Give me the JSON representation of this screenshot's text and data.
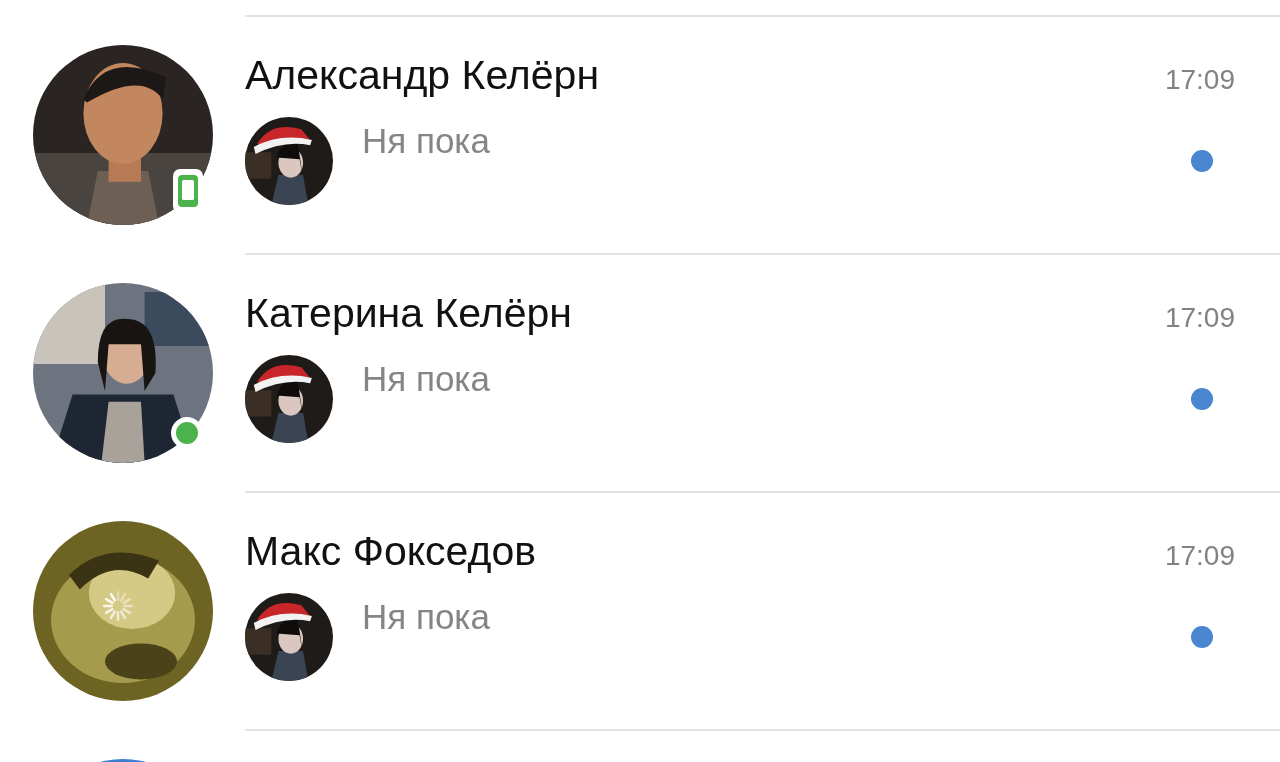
{
  "chats": [
    {
      "name": "Александр Келёрн",
      "time": "17:09",
      "preview": "Ня пока",
      "online": true,
      "mobile": true,
      "unread": true,
      "loading": false
    },
    {
      "name": "Катерина Келёрн",
      "time": "17:09",
      "preview": "Ня пока",
      "online": true,
      "mobile": false,
      "unread": true,
      "loading": false
    },
    {
      "name": "Макс Фокседов",
      "time": "17:09",
      "preview": "Ня пока",
      "online": false,
      "unread": true,
      "loading": true
    }
  ]
}
